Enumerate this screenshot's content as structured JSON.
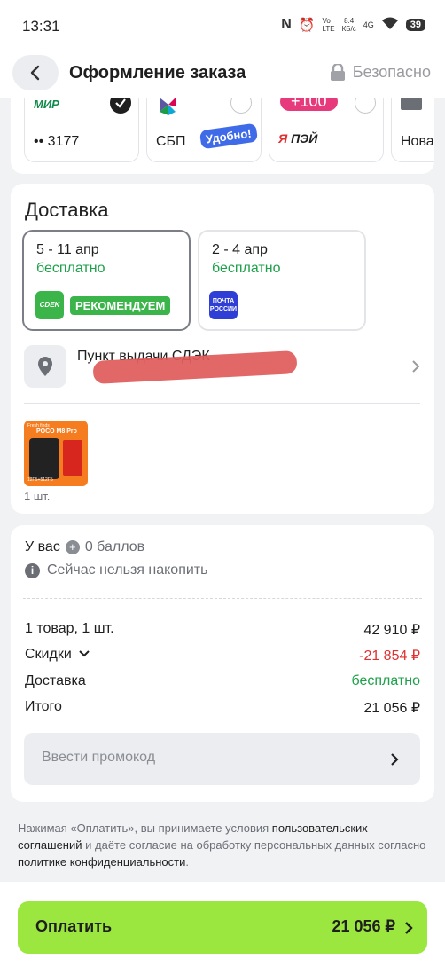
{
  "status_bar": {
    "time": "13:31",
    "net_speed": "8.4\nКБ/с",
    "lte": "Vo\nLTE",
    "g4": "4G",
    "battery": "39"
  },
  "header": {
    "title": "Оформление заказа",
    "secure_label": "Безопасно"
  },
  "payment_methods": {
    "items": [
      {
        "logo": "МИР",
        "label": "•• 3177",
        "selected": true
      },
      {
        "label": "СБП",
        "badge": "Удобно!",
        "selected": false
      },
      {
        "label": "Я ПЭЙ",
        "badge_top": "100",
        "selected": false
      },
      {
        "label": "Нова",
        "selected": false
      }
    ]
  },
  "delivery": {
    "title": "Доставка",
    "options": [
      {
        "dates": "5 - 11 апр",
        "price": "бесплатно",
        "carrier": "CDEK",
        "tag": "РЕКОМЕНДУЕМ",
        "selected": true
      },
      {
        "dates": "2 - 4 апр",
        "price": "бесплатно",
        "carrier_line1": "ПОЧТА",
        "carrier_line2": "РОССИИ",
        "selected": false
      }
    ],
    "pickup_label": "Пункт выдачи СДЭК",
    "product": {
      "name": "POCO M8 Pro",
      "brand_tag": "Fresh finds",
      "memory": "12ГБ+512ГБ",
      "qty": "1 шт."
    }
  },
  "points": {
    "prefix": "У вас",
    "balance": "0 баллов",
    "note": "Сейчас нельзя накопить"
  },
  "totals": {
    "items": {
      "label": "1 товар, 1 шт.",
      "value": "42 910 ₽"
    },
    "discounts": {
      "label": "Скидки",
      "value": "-21 854 ₽"
    },
    "delivery": {
      "label": "Доставка",
      "value": "бесплатно"
    },
    "total": {
      "label": "Итого",
      "value": "21 056 ₽"
    }
  },
  "promo": {
    "placeholder": "Ввести промокод"
  },
  "legal": {
    "p1": "Нажимая «Оплатить», вы принимаете условия ",
    "link1": "пользовательских соглашений",
    "p2": " и даёте согласие на обработку персональных данных согласно ",
    "link2": "политике конфиденциальности",
    "p3": "."
  },
  "pay_button": {
    "label": "Оплатить",
    "amount": "21 056 ₽"
  },
  "colors": {
    "accent": "#9be63f",
    "green": "#1ea14a",
    "red": "#e03131",
    "cdek": "#3bb54a",
    "pochta": "#2f3fd6"
  }
}
